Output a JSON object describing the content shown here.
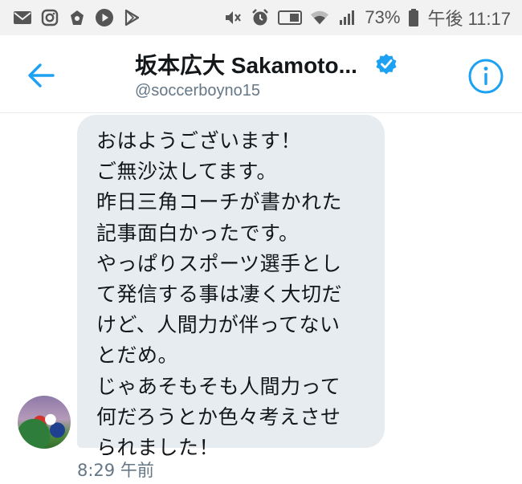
{
  "status_bar": {
    "battery_percent": "73%",
    "time": "午後 11:17",
    "left_icons": [
      "mail-icon",
      "instagram-icon",
      "line-game-icon",
      "play-circle-icon",
      "play-store-icon"
    ],
    "right_icons": [
      "mute-icon",
      "alarm-icon",
      "volte-icon",
      "wifi-icon",
      "signal-icon",
      "battery-icon"
    ]
  },
  "header": {
    "title": "坂本広大 Sakamoto...",
    "handle": "@soccerboyno15",
    "verified": true,
    "accent_color": "#1da1f2"
  },
  "conversation": {
    "message_lines": [
      "おはようございます！",
      "ご無沙汰してます。",
      "昨日三角コーチが書かれた",
      "記事面白かったです。",
      "やっぱりスポーツ選手とし",
      "て発信する事は凄く大切だ",
      "けど、人間力が伴ってない",
      "とだめ。",
      "じゃあそもそも人間力って",
      "何だろうとか色々考えさせ",
      "られました！"
    ],
    "timestamp": "8:29 午前",
    "bubble_color": "#e6ecf0"
  }
}
